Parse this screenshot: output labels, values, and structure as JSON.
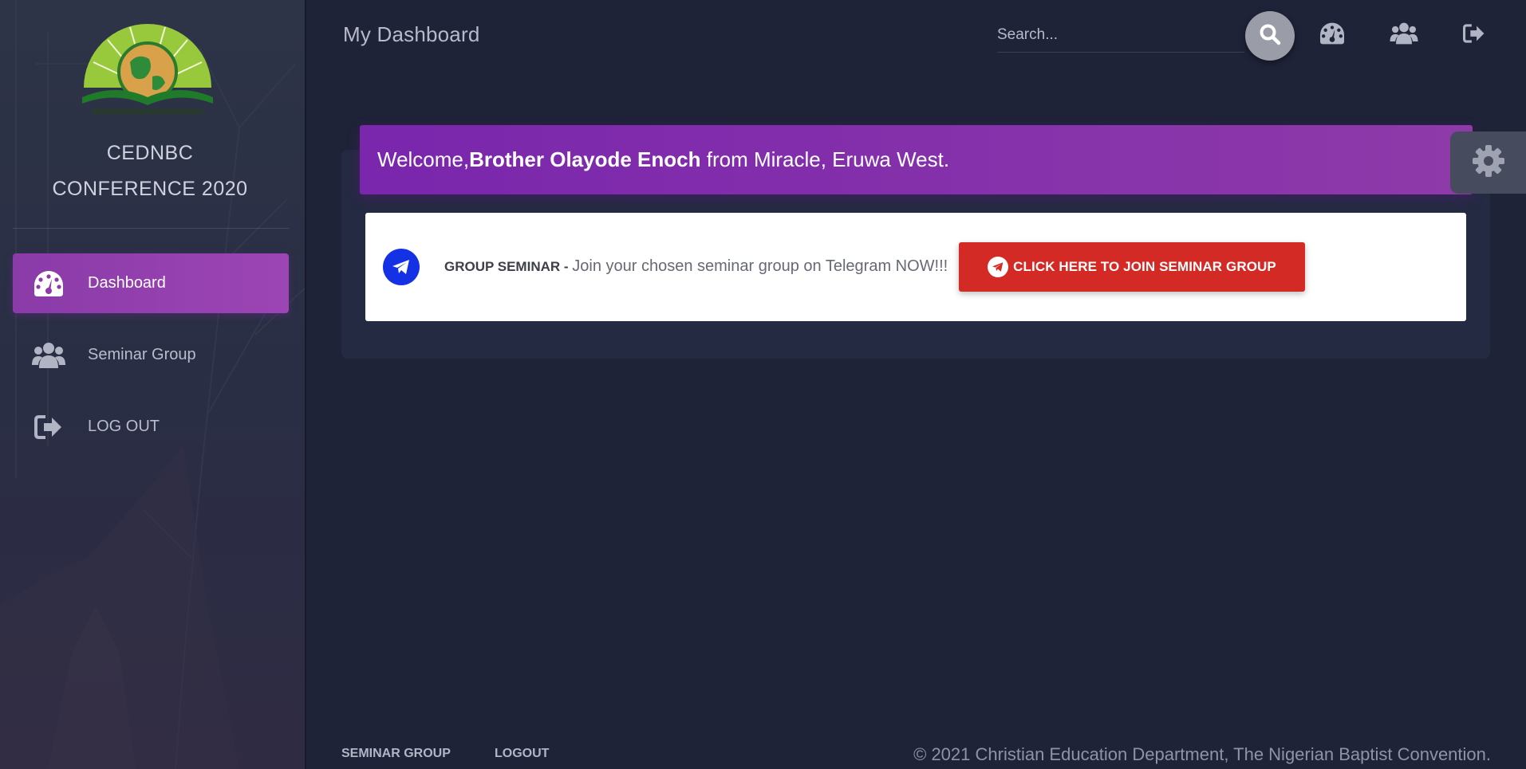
{
  "sidebar": {
    "brand_line1": "CEDNBC",
    "brand_line2": "CONFERENCE 2020",
    "items": [
      {
        "label": "Dashboard",
        "icon": "dashboard-gauge-icon",
        "active": true
      },
      {
        "label": "Seminar Group",
        "icon": "users-icon",
        "active": false
      },
      {
        "label": "LOG OUT",
        "icon": "logout-icon",
        "active": false
      }
    ]
  },
  "header": {
    "title": "My Dashboard",
    "search_placeholder": "Search...",
    "icons": [
      "search-icon",
      "dashboard-gauge-icon",
      "users-icon",
      "logout-icon"
    ]
  },
  "welcome": {
    "prefix": "Welcome, ",
    "name": "Brother Olayode Enoch",
    "suffix": " from Miracle, Eruwa West."
  },
  "seminar": {
    "label": "GROUP SEMINAR - ",
    "text": "Join your chosen seminar group on Telegram NOW!!!",
    "button_label": "CLICK HERE TO JOIN SEMINAR GROUP"
  },
  "footer": {
    "links": [
      "SEMINAR GROUP",
      "LOGOUT"
    ],
    "copyright": "© 2021 Christian Education Department, The Nigerian Baptist Convention."
  },
  "colors": {
    "accent": "#8e3aa9",
    "button_red": "#d42a25",
    "telegram_blue": "#1431e6",
    "background": "#1f2338"
  }
}
